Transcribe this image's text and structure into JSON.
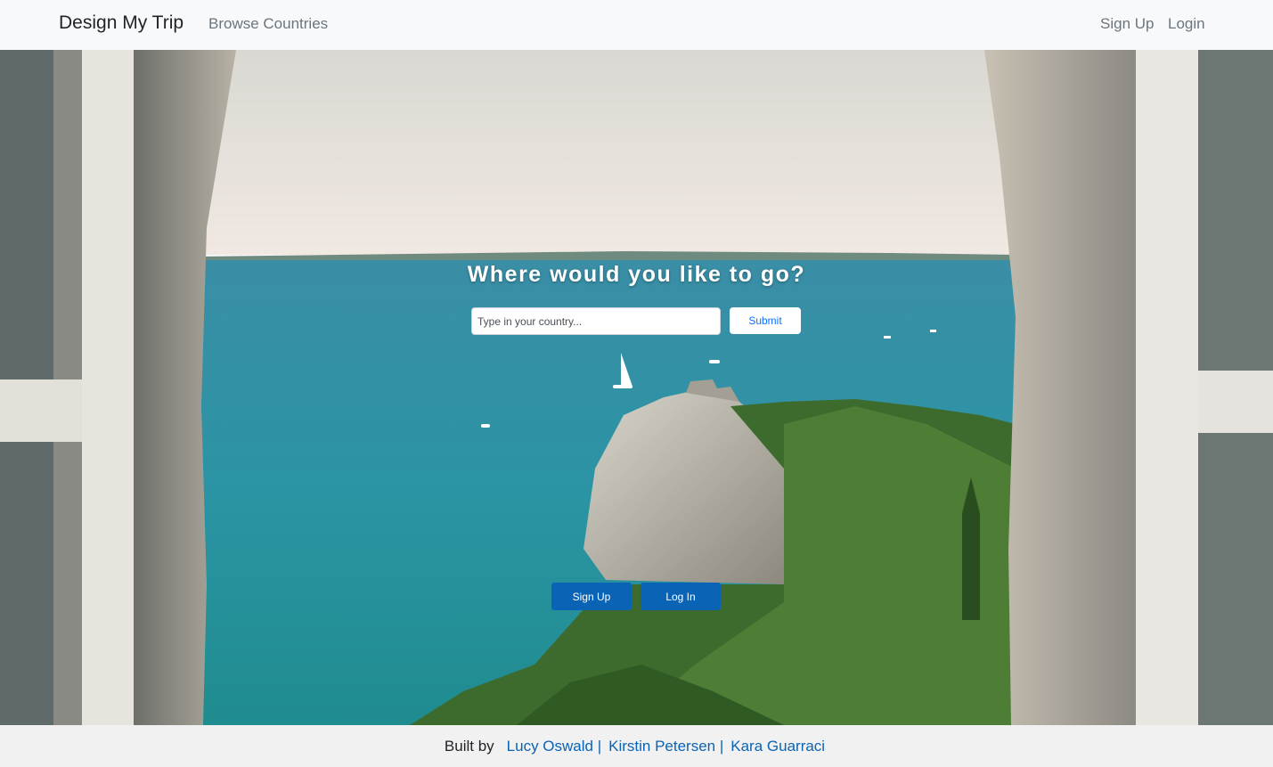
{
  "nav": {
    "brand": "Design My Trip",
    "browse": "Browse Countries",
    "signup": "Sign Up",
    "login": "Login"
  },
  "hero": {
    "title": "Where would you like to go?",
    "search_placeholder": "Type in your country...",
    "search_value": "",
    "submit_label": "Submit",
    "signup_label": "Sign Up",
    "login_label": "Log In"
  },
  "footer": {
    "built_by": "Built by",
    "authors": [
      "Lucy Oswald |",
      "Kirstin Petersen |",
      "Kara Guarraci"
    ]
  },
  "colors": {
    "accent": "#0b63b5",
    "sea": "#2a93a0",
    "sky": "#eee8e2",
    "navbar": "#f8f9fa"
  }
}
